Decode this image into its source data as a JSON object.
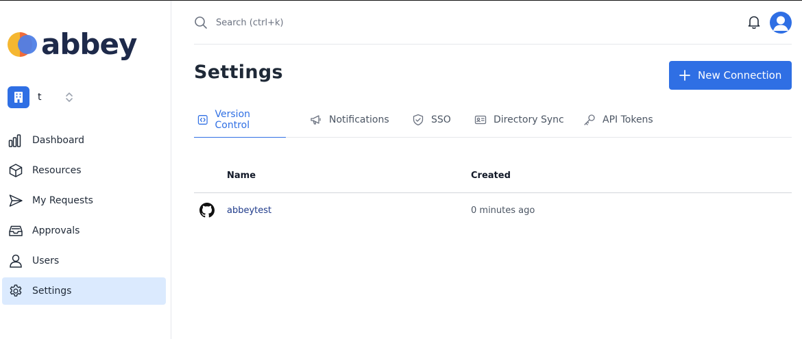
{
  "app": {
    "brand": "abbey",
    "org_name": "t"
  },
  "sidebar": {
    "items": [
      {
        "label": "Dashboard",
        "icon": "bar-chart-icon"
      },
      {
        "label": "Resources",
        "icon": "cube-icon"
      },
      {
        "label": "My Requests",
        "icon": "send-icon"
      },
      {
        "label": "Approvals",
        "icon": "inbox-icon"
      },
      {
        "label": "Users",
        "icon": "user-icon"
      },
      {
        "label": "Settings",
        "icon": "gear-icon",
        "active": true
      }
    ]
  },
  "header": {
    "search_placeholder": "Search (ctrl+k)"
  },
  "main": {
    "title": "Settings",
    "new_button_label": "New Connection",
    "tabs": [
      {
        "label": "Version Control",
        "icon": "code-icon",
        "active": true
      },
      {
        "label": "Notifications",
        "icon": "megaphone-icon"
      },
      {
        "label": "SSO",
        "icon": "shield-check-icon"
      },
      {
        "label": "Directory Sync",
        "icon": "id-card-icon"
      },
      {
        "label": "API Tokens",
        "icon": "key-icon"
      }
    ],
    "table": {
      "columns": [
        "Name",
        "Created"
      ],
      "rows": [
        {
          "icon": "github-icon",
          "name": "abbeytest",
          "created": "0 minutes ago"
        }
      ]
    }
  },
  "colors": {
    "accent": "#2f6fe4",
    "active_bg": "#dbeafe",
    "brand_text": "#1e2a4a",
    "link": "#1e3a8a"
  }
}
